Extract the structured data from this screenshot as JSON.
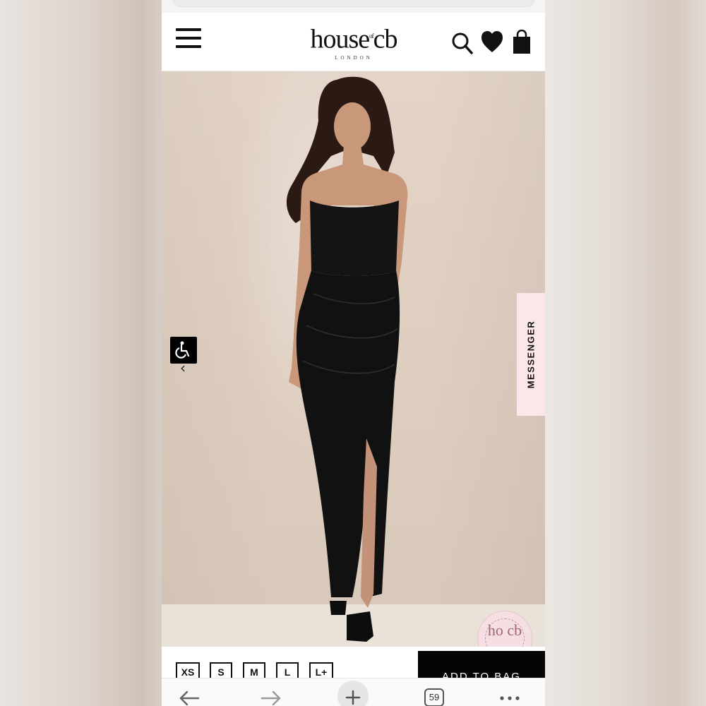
{
  "header": {
    "logo_text": "house",
    "logo_of": "of",
    "logo_cb": "cb",
    "logo_sub": "LONDON",
    "menu_icon": "hamburger-menu-icon",
    "search_icon": "search-icon",
    "wishlist_icon": "heart-icon",
    "bag_icon": "shopping-bag-icon"
  },
  "hero": {
    "accessibility_icon": "wheelchair-icon",
    "prev_arrow": "‹",
    "messenger_label": "MESSENGER",
    "watermark_text": "ho cb"
  },
  "product": {
    "sizes": [
      "XS",
      "S",
      "M",
      "L",
      "L+"
    ],
    "add_to_bag_label": "ADD TO BAG"
  },
  "browser": {
    "back_icon": "back-arrow-icon",
    "forward_icon": "forward-arrow-icon",
    "new_tab_icon": "plus-icon",
    "tab_count": "59",
    "more_icon": "more-dots-icon"
  },
  "colors": {
    "accent_black": "#050505",
    "messenger_bg": "#fbe7e9",
    "page_bg": "#ffffff"
  }
}
